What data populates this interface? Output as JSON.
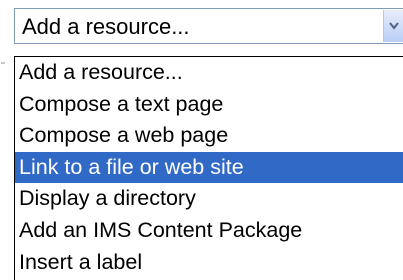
{
  "select": {
    "current_value": "Add a resource...",
    "dropdown_icon": "chevron-down-icon"
  },
  "options": [
    {
      "label": "Add a resource..."
    },
    {
      "label": "Compose a text page"
    },
    {
      "label": "Compose a web page"
    },
    {
      "label": "Link to a file or web site"
    },
    {
      "label": "Display a directory"
    },
    {
      "label": "Add an IMS Content Package"
    },
    {
      "label": "Insert a label"
    }
  ],
  "selected_option": "Link to a file or web site",
  "colors": {
    "highlight": "#3169c6",
    "highlight_text": "#ffffff",
    "border": "#7f9db9"
  }
}
